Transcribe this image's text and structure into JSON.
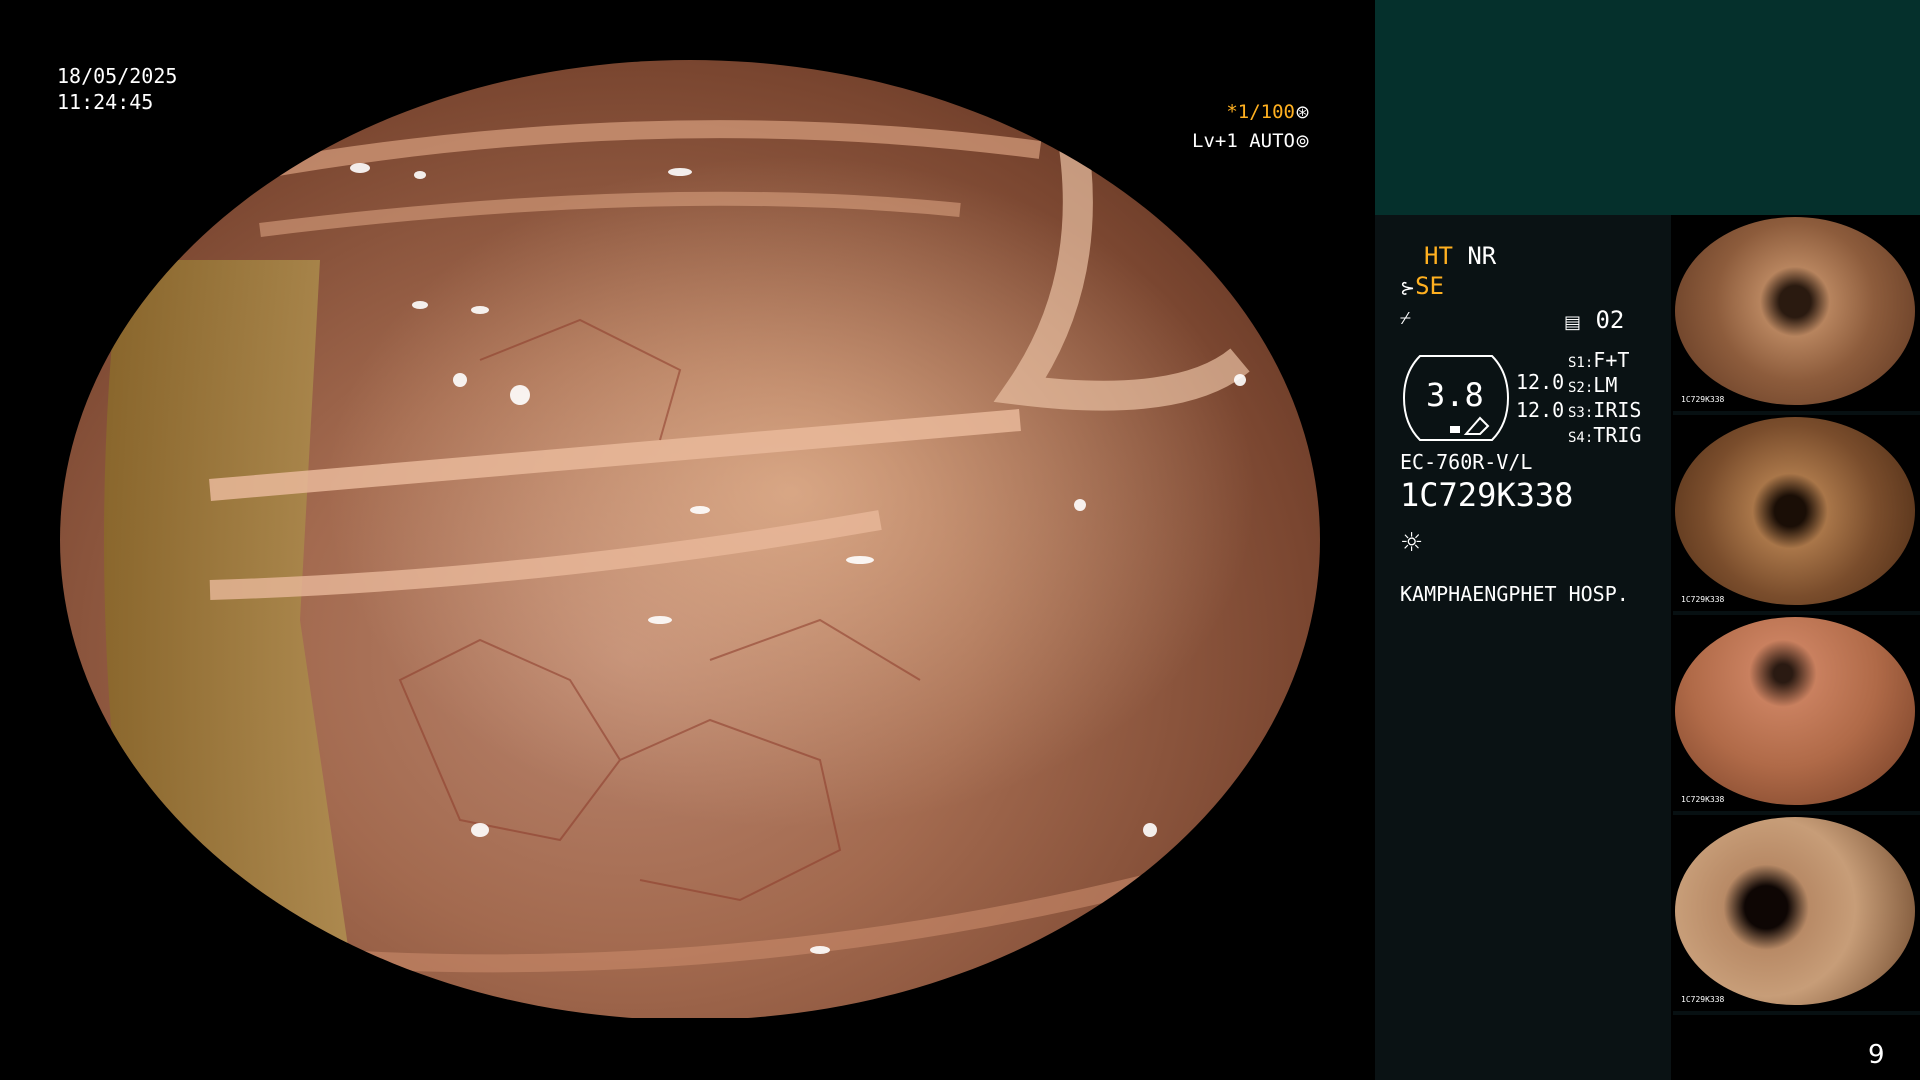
{
  "overlay": {
    "date": "18/05/2025",
    "time": "11:24:45",
    "shutter": "*1/100",
    "shutter_icon": "aperture-icon",
    "level": "Lv+1 AUTO",
    "level_icon": "iris-icon"
  },
  "panel": {
    "mode_ht": "HT",
    "mode_nr": "NR",
    "se_icon": "scope-icon",
    "se": "SE",
    "enhance_icon": "enhance-icon",
    "preset_icon": "memory-icon",
    "preset": "02",
    "gauge_value": "3.8",
    "readout_1": "12.0",
    "readout_2": "12.0",
    "switches": [
      {
        "key": "S1:",
        "value": "F+T"
      },
      {
        "key": "S2:",
        "value": "LM"
      },
      {
        "key": "S3:",
        "value": "IRIS"
      },
      {
        "key": "S4:",
        "value": "TRIG"
      }
    ],
    "scope_model": "EC-760R-V/L",
    "serial": "1C729K338",
    "light_icon": "sun-icon",
    "hospital": "KAMPHAENGPHET HOSP."
  },
  "thumbnails": [
    {
      "id": "thumb-1",
      "serial": "1C729K338",
      "tone": "#b7845e"
    },
    {
      "id": "thumb-2",
      "serial": "1C729K338",
      "tone": "#a97649"
    },
    {
      "id": "thumb-3",
      "serial": "1C729K338",
      "tone": "#c9805f"
    },
    {
      "id": "thumb-4",
      "serial": "1C729K338",
      "tone": "#b88a66"
    }
  ],
  "page_number": "9",
  "colors": {
    "accent": "#ffb020",
    "panel_top": "#05302c",
    "panel": "#0a1214"
  }
}
